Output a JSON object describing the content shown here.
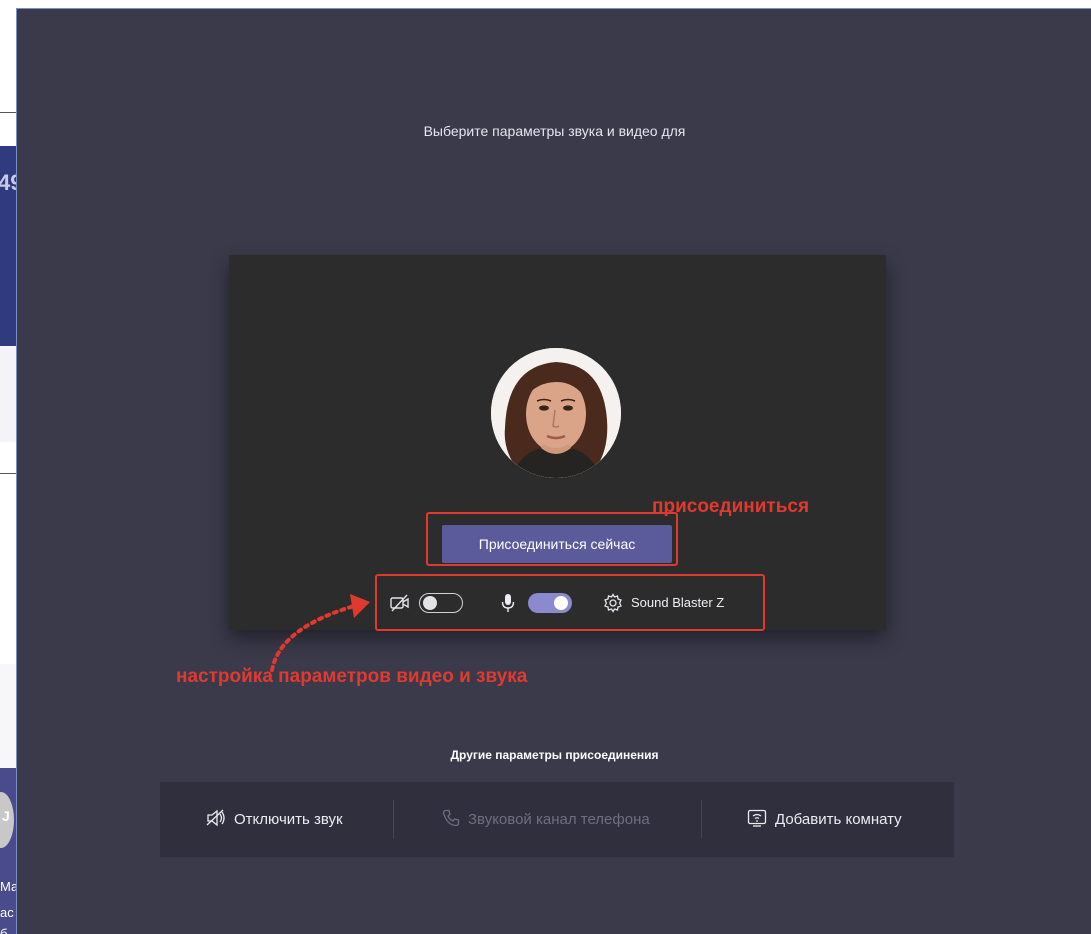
{
  "background_app": {
    "header_fragment": "49",
    "avatar_letter": "J",
    "side_text_lines": [
      "Ма",
      "ас",
      "б"
    ]
  },
  "prejoin": {
    "title": "Выберите параметры звука и видео для",
    "join_button": "Присоединиться сейчас",
    "camera_enabled": false,
    "mic_enabled": true,
    "device_label": "Sound Blaster Z"
  },
  "annotations": {
    "join": "присоединиться",
    "settings": "настройка параметров видео и звука",
    "color": "#e2392f"
  },
  "other_options": {
    "title": "Другие параметры присоединения",
    "items": [
      {
        "label": "Отключить звук",
        "icon": "speaker-off-icon",
        "enabled": true
      },
      {
        "label": "Звуковой канал телефона",
        "icon": "phone-icon",
        "enabled": false
      },
      {
        "label": "Добавить комнату",
        "icon": "cast-room-icon",
        "enabled": true
      }
    ]
  },
  "colors": {
    "panel_bg": "#3b3a4a",
    "preview_bg": "#2d2c2c",
    "accent": "#5b5a9b",
    "toggle_on": "#8b8ace"
  }
}
